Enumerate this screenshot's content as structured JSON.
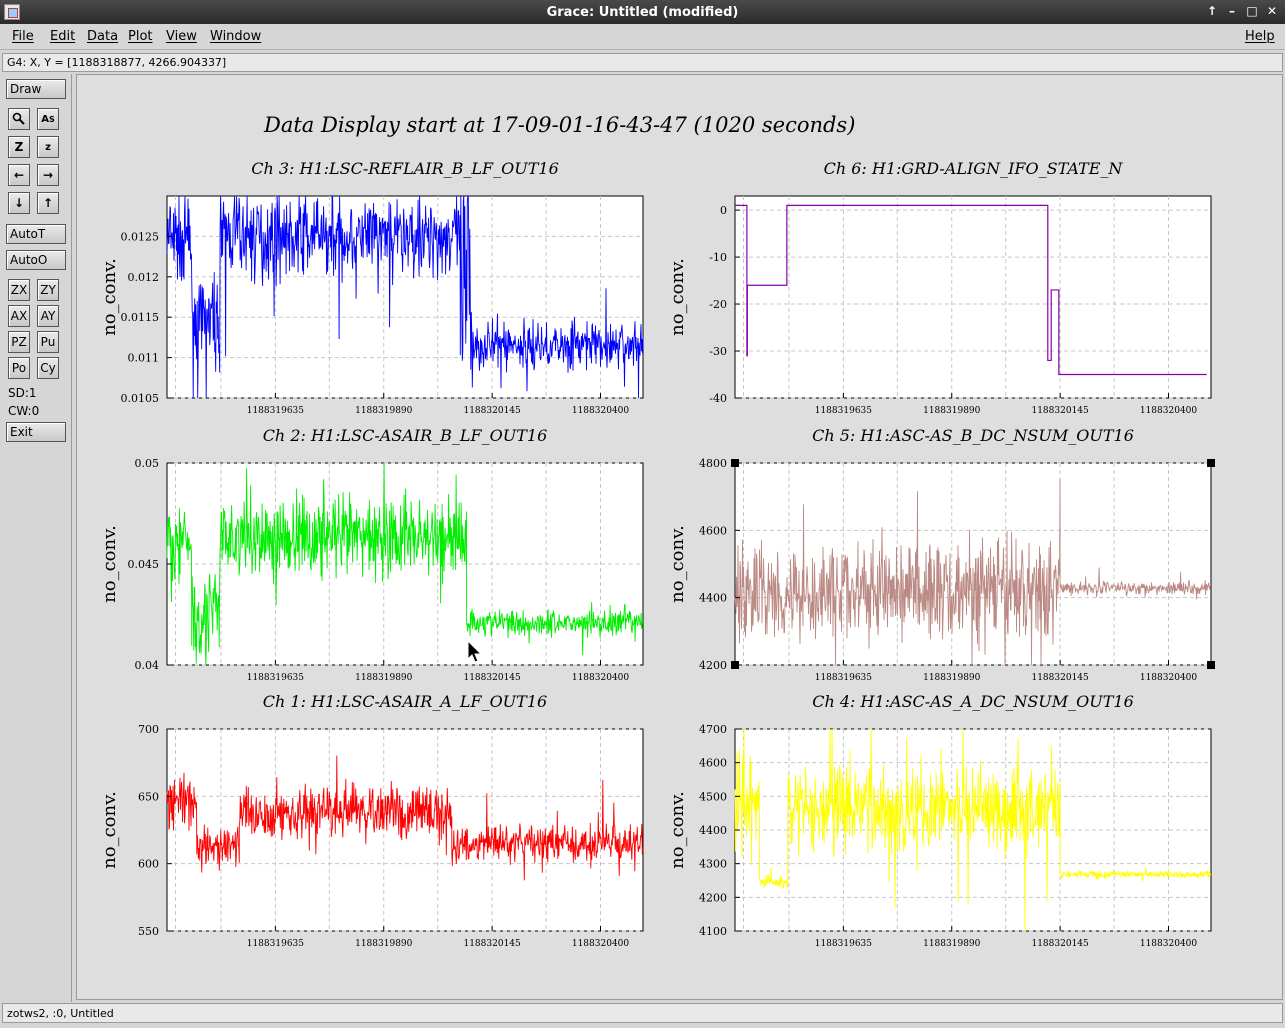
{
  "window": {
    "title": "Grace: Untitled (modified)",
    "buttons": [
      "↑",
      "–",
      "□",
      "✕"
    ]
  },
  "menu": {
    "items": [
      "File",
      "Edit",
      "Data",
      "Plot",
      "View",
      "Window"
    ],
    "help": "Help"
  },
  "locator": "G4: X, Y = [1188318877, 4266.904337]",
  "tools": {
    "draw": "Draw",
    "autot": "AutoT",
    "autoo": "AutoO",
    "exit": "Exit",
    "sd": "SD:1",
    "cw": "CW:0",
    "grid": [
      "ZX",
      "ZY",
      "AX",
      "AY",
      "PZ",
      "Pu",
      "Po",
      "Cy"
    ]
  },
  "status": "zotws2, :0, Untitled",
  "plot_title": "Data Display start at 17-09-01-16-43-47 (1020 seconds)",
  "chart_data": [
    {
      "type": "line",
      "title": "Ch 3: H1:LSC-REFLAIR_B_LF_OUT16",
      "ylabel": "no_conv.",
      "color": "#0000ff",
      "ylim": [
        0.0105,
        0.013
      ],
      "yticks": [
        "0.0105",
        "0.011",
        "0.0115",
        "0.012",
        "0.0125"
      ],
      "xlim": [
        1188319380,
        1188320500
      ],
      "xticks": [
        "1188319635",
        "1188319890",
        "1188320145",
        "1188320400"
      ],
      "segments": [
        {
          "x": [
            1188319380,
            1188319438
          ],
          "y": 0.01245,
          "noise": 0.00035
        },
        {
          "x": [
            1188319438,
            1188319505
          ],
          "y": 0.01145,
          "noise": 0.0003
        },
        {
          "x": [
            1188319505,
            1188320070
          ],
          "y": 0.0125,
          "noise": 0.0003
        },
        {
          "x": [
            1188320070,
            1188320100
          ],
          "y": 0.0117,
          "noise": 0.001
        },
        {
          "x": [
            1188320100,
            1188320500
          ],
          "y": 0.01115,
          "noise": 0.00018
        }
      ]
    },
    {
      "type": "line",
      "title": "Ch 6: H1:GRD-ALIGN_IFO_STATE_N",
      "ylabel": "no_conv.",
      "color": "#8800aa",
      "ylim": [
        -40,
        3
      ],
      "yticks": [
        "-40",
        "-30",
        "-20",
        "-10",
        "0"
      ],
      "xlim": [
        1188319380,
        1188320500
      ],
      "xticks": [
        "1188319635",
        "1188319890",
        "1188320145",
        "1188320400"
      ],
      "steps": [
        {
          "x": 1188319380,
          "y": 1
        },
        {
          "x": 1188319408,
          "y": -31
        },
        {
          "x": 1188319409,
          "y": -16
        },
        {
          "x": 1188319502,
          "y": 1
        },
        {
          "x": 1188320116,
          "y": -32
        },
        {
          "x": 1188320124,
          "y": -17
        },
        {
          "x": 1188320142,
          "y": -35
        },
        {
          "x": 1188320490,
          "y": -35
        }
      ]
    },
    {
      "type": "line",
      "title": "Ch 2: H1:LSC-ASAIR_B_LF_OUT16",
      "ylabel": "no_conv.",
      "color": "#00ee00",
      "ylim": [
        0.04,
        0.05
      ],
      "yticks": [
        "0.04",
        "0.045",
        "0.05"
      ],
      "xlim": [
        1188319380,
        1188320500
      ],
      "xticks": [
        "1188319635",
        "1188319890",
        "1188320145",
        "1188320400"
      ],
      "segments": [
        {
          "x": [
            1188319380,
            1188319438
          ],
          "y": 0.0461,
          "noise": 0.0012
        },
        {
          "x": [
            1188319438,
            1188319505
          ],
          "y": 0.0426,
          "noise": 0.0016
        },
        {
          "x": [
            1188319505,
            1188320085
          ],
          "y": 0.0463,
          "noise": 0.0012
        },
        {
          "x": [
            1188320085,
            1188320500
          ],
          "y": 0.0421,
          "noise": 0.0004
        }
      ]
    },
    {
      "type": "line",
      "title": "Ch 5: H1:ASC-AS_B_DC_NSUM_OUT16",
      "ylabel": "no_conv.",
      "color": "#bc8a84",
      "ylim": [
        4200,
        4800
      ],
      "yticks": [
        "4200",
        "4400",
        "4600",
        "4800"
      ],
      "xlim": [
        1188319380,
        1188320500
      ],
      "xticks": [
        "1188319635",
        "1188319890",
        "1188320145",
        "1188320400"
      ],
      "segments": [
        {
          "x": [
            1188319380,
            1188320145
          ],
          "y": 4420,
          "noise": 90
        },
        {
          "x": [
            1188320145,
            1188320500
          ],
          "y": 4430,
          "noise": 12
        }
      ]
    },
    {
      "type": "line",
      "title": "Ch 1: H1:LSC-ASAIR_A_LF_OUT16",
      "ylabel": "no_conv.",
      "color": "#ff0000",
      "ylim": [
        550,
        700
      ],
      "yticks": [
        "550",
        "600",
        "650",
        "700"
      ],
      "xlim": [
        1188319380,
        1188320500
      ],
      "xticks": [
        "1188319635",
        "1188319890",
        "1188320145",
        "1188320400"
      ],
      "segments": [
        {
          "x": [
            1188319380,
            1188319450
          ],
          "y": 645,
          "noise": 12
        },
        {
          "x": [
            1188319450,
            1188319550
          ],
          "y": 612,
          "noise": 10
        },
        {
          "x": [
            1188319550,
            1188320050
          ],
          "y": 638,
          "noise": 12
        },
        {
          "x": [
            1188320050,
            1188320500
          ],
          "y": 615,
          "noise": 8
        }
      ]
    },
    {
      "type": "line",
      "title": "Ch 4: H1:ASC-AS_A_DC_NSUM_OUT16",
      "ylabel": "no_conv.",
      "color": "#ffff00",
      "ylim": [
        4100,
        4700
      ],
      "yticks": [
        "4100",
        "4200",
        "4300",
        "4400",
        "4500",
        "4600",
        "4700"
      ],
      "xlim": [
        1188319380,
        1188320500
      ],
      "xticks": [
        "1188319635",
        "1188319890",
        "1188320145",
        "1188320400"
      ],
      "segments": [
        {
          "x": [
            1188319380,
            1188319438
          ],
          "y": 4470,
          "noise": 80
        },
        {
          "x": [
            1188319438,
            1188319505
          ],
          "y": 4245,
          "noise": 12
        },
        {
          "x": [
            1188319505,
            1188320145
          ],
          "y": 4465,
          "noise": 80
        },
        {
          "x": [
            1188320145,
            1188320500
          ],
          "y": 4268,
          "noise": 6
        }
      ]
    }
  ]
}
